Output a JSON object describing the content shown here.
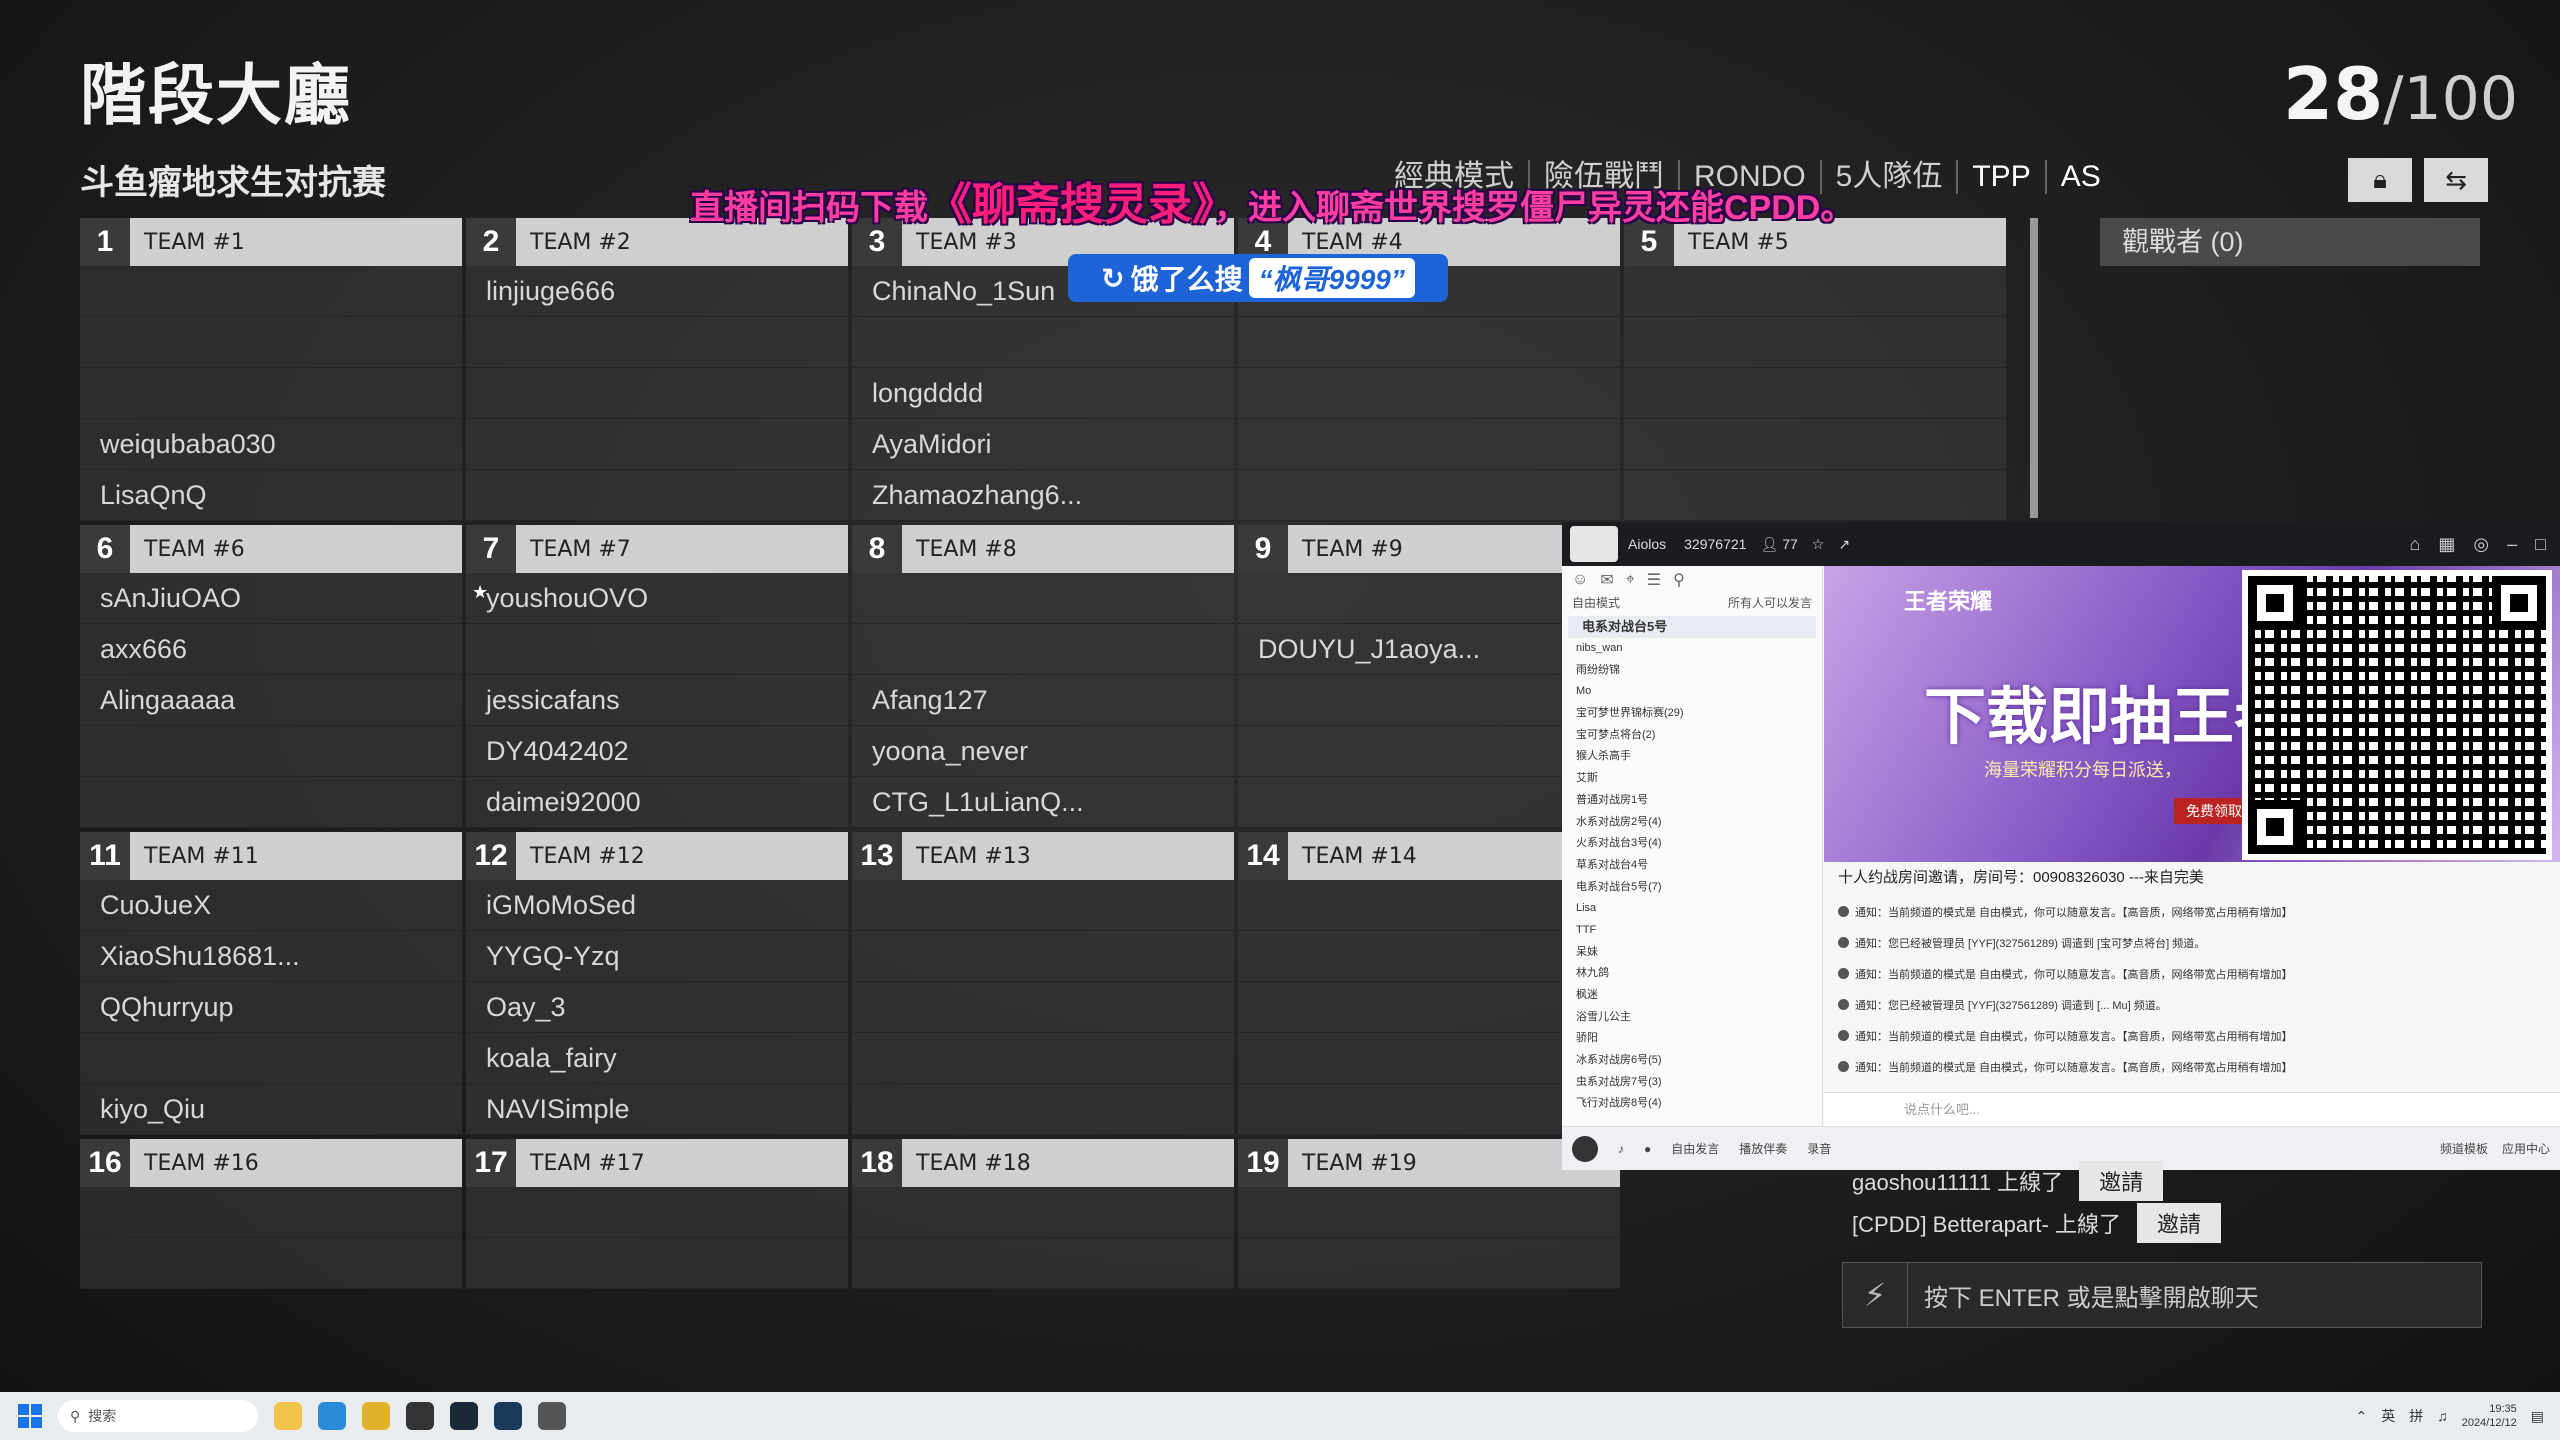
{
  "lobby": {
    "title": "階段大廳",
    "subtitle": "斗鱼瘤地求生对抗赛",
    "count": "28",
    "max": "/100",
    "modes": [
      "經典模式",
      "險伍戰鬥",
      "RONDO",
      "5人隊伍",
      "TPP",
      "AS"
    ],
    "lock_icon": "lock-icon",
    "swap_icon": "swap-icon",
    "spectators": "觀戰者 (0)"
  },
  "overlay": {
    "promo_pre": "直播间扫码下载",
    "promo_title": "《聊斋搜灵录》",
    "promo_post": "，进入聊斋世界搜罗僵尸异灵还能CPDD。",
    "search_label": "饿了么搜",
    "search_query": "“枫哥9999”"
  },
  "teams": [
    {
      "num": "1",
      "name": "TEAM #1",
      "players": [
        "",
        "",
        "",
        "weiqubaba030",
        "LisaQnQ"
      ]
    },
    {
      "num": "2",
      "name": "TEAM #2",
      "players": [
        "linjiuge666",
        "",
        "",
        "",
        ""
      ]
    },
    {
      "num": "3",
      "name": "TEAM #3",
      "players": [
        "ChinaNo_1Sun",
        "",
        "longdddd",
        "AyaMidori",
        "Zhamaozhang6..."
      ]
    },
    {
      "num": "4",
      "name": "TEAM #4",
      "players": [
        "",
        "",
        "",
        "",
        ""
      ]
    },
    {
      "num": "5",
      "name": "TEAM #5",
      "players": [
        "",
        "",
        "",
        "",
        ""
      ]
    },
    {
      "num": "6",
      "name": "TEAM #6",
      "players": [
        "sAnJiuOAO",
        "axx666",
        "Alingaaaaa",
        "",
        ""
      ]
    },
    {
      "num": "7",
      "name": "TEAM #7",
      "players": [
        "youshouOVO",
        "",
        "jessicafans",
        "DY4042402",
        "daimei92000"
      ]
    },
    {
      "num": "8",
      "name": "TEAM #8",
      "players": [
        "",
        "",
        "Afang127",
        "yoona_never",
        "CTG_L1uLianQ..."
      ]
    },
    {
      "num": "9",
      "name": "TEAM #9",
      "players": [
        "",
        "DOUYU_J1aoya...",
        "",
        "",
        ""
      ]
    },
    {
      "num": "11",
      "name": "TEAM #11",
      "players": [
        "CuoJueX",
        "XiaoShu18681...",
        "QQhurryup",
        "",
        "kiyo_Qiu"
      ]
    },
    {
      "num": "12",
      "name": "TEAM #12",
      "players": [
        "iGMoMoSed",
        "YYGQ-Yzq",
        "Oay_3",
        "koala_fairy",
        "NAVISimple"
      ]
    },
    {
      "num": "13",
      "name": "TEAM #13",
      "players": [
        "",
        "",
        "",
        "",
        ""
      ]
    },
    {
      "num": "14",
      "name": "TEAM #14",
      "players": [
        "",
        "",
        "",
        "",
        ""
      ]
    },
    {
      "num": "16",
      "name": "TEAM #16",
      "players": [
        "",
        ""
      ]
    },
    {
      "num": "17",
      "name": "TEAM #17",
      "players": [
        "",
        ""
      ]
    },
    {
      "num": "18",
      "name": "TEAM #18",
      "players": [
        "",
        ""
      ]
    },
    {
      "num": "19",
      "name": "TEAM #19",
      "players": [
        "",
        ""
      ]
    }
  ],
  "chat": {
    "lines": [
      {
        "text": "gaoshou11111 上線了",
        "action": "邀請"
      },
      {
        "text": "[CPDD] Betterapart- 上線了",
        "action": "邀請"
      }
    ],
    "input_placeholder": "按下 ENTER 或是點擊開啟聊天"
  },
  "stream_app": {
    "user": "Aiolos",
    "room_id": "32976721",
    "viewers": "77",
    "mode": "自由模式",
    "mode_note": "所有人可以发言",
    "channel": "电系对战台5号",
    "tree": [
      "nibs_wan",
      "雨纷纷锦",
      "Mo",
      "宝可梦世界锦标赛(29)",
      "宝可梦点将台(2)",
      "猴人杀高手",
      "艾斯",
      "普通对战房1号",
      "水系对战房2号(4)",
      "火系对战台3号(4)",
      "草系对战台4号",
      "电系对战台5号(7)",
      "Lisa",
      "TTF",
      "呆妹",
      "林九鸽",
      "枫迷",
      "浴雪儿公主",
      "骄阳",
      "冰系对战房6号(5)",
      "虫系对战房7号(3)",
      "飞行对战房8号(4)"
    ],
    "banner_logo": "王者荣耀",
    "banner_text": "下载即抽王者",
    "banner_sub": "海量荣耀积分每日派送，",
    "banner_btn": "免费领取",
    "invite_line": "十人约战房间邀请，房间号：00908326030 ---来自完美",
    "messages": [
      "通知：当前频道的模式是 自由模式，你可以随意发言。【高音质，网络带宽占用稍有增加】",
      "通知：您已经被管理员 [YYF](327561289) 调遣到 [宝可梦点将台] 频道。",
      "通知：当前频道的模式是 自由模式，你可以随意发言。【高音质，网络带宽占用稍有增加】",
      "通知：您已经被管理员 [YYF](327561289) 调遣到 [... Mu] 频道。",
      "通知：当前频道的模式是 自由模式，你可以随意发言。【高音质，网络带宽占用稍有增加】",
      "通知：当前频道的模式是 自由模式，你可以随意发言。【高音质，网络带宽占用稍有增加】"
    ],
    "input_placeholder": "说点什么吧...",
    "bottom": [
      "自由发言",
      "播放伴奏",
      "录音"
    ],
    "bottom_right": [
      "频道模板",
      "应用中心"
    ]
  },
  "taskbar": {
    "search": "搜索",
    "ime": [
      "英",
      "拼"
    ],
    "time": "19:35",
    "date": "2024/12/12"
  }
}
